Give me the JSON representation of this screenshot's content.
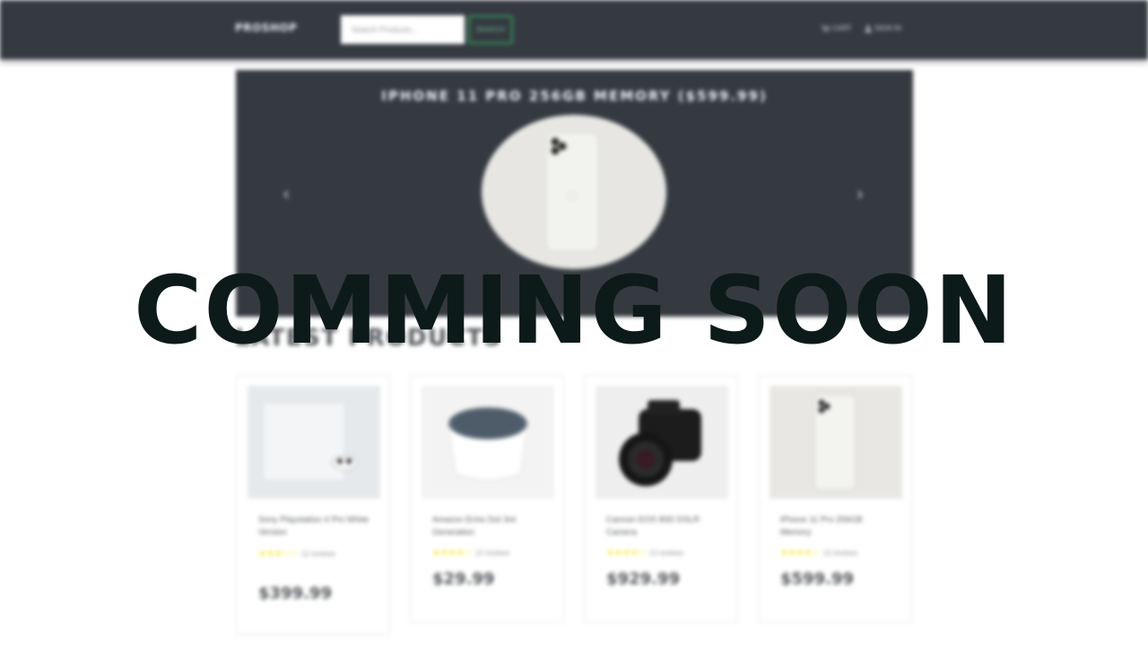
{
  "navbar": {
    "brand": "PROSHOP",
    "search_placeholder": "Search Products...",
    "search_button": "SEARCH",
    "cart_label": "CART",
    "signin_label": "SIGN IN",
    "background": "#353a41"
  },
  "carousel": {
    "caption": "IPHONE 11 PRO 256GB MEMORY ($599.99)",
    "prev_icon": "chevron-left-icon",
    "next_icon": "chevron-right-icon"
  },
  "section": {
    "title": "LATEST PRODUCTS"
  },
  "products": [
    {
      "name": "Sony Playstation 4 Pro White Version",
      "rating": 3.5,
      "stars": "★★★☆☆",
      "reviews": "12 reviews",
      "price": "$399.99"
    },
    {
      "name": "Amazon Echo Dot 3rd Generation",
      "rating": 4,
      "stars": "★★★★☆",
      "reviews": "12 reviews",
      "price": "$29.99"
    },
    {
      "name": "Cannon EOS 80D DSLR Camera",
      "rating": 3.5,
      "stars": "★★★★☆",
      "reviews": "12 reviews",
      "price": "$929.99"
    },
    {
      "name": "iPhone 11 Pro 256GB Memory",
      "rating": 4,
      "stars": "★★★★☆",
      "reviews": "12 reviews",
      "price": "$599.99"
    }
  ],
  "overlay": {
    "text": "COMMING SOON"
  },
  "colors": {
    "star": "#f8e825",
    "search_button_border": "#2f9e5a",
    "overlay_text": "#0d1a1a"
  }
}
